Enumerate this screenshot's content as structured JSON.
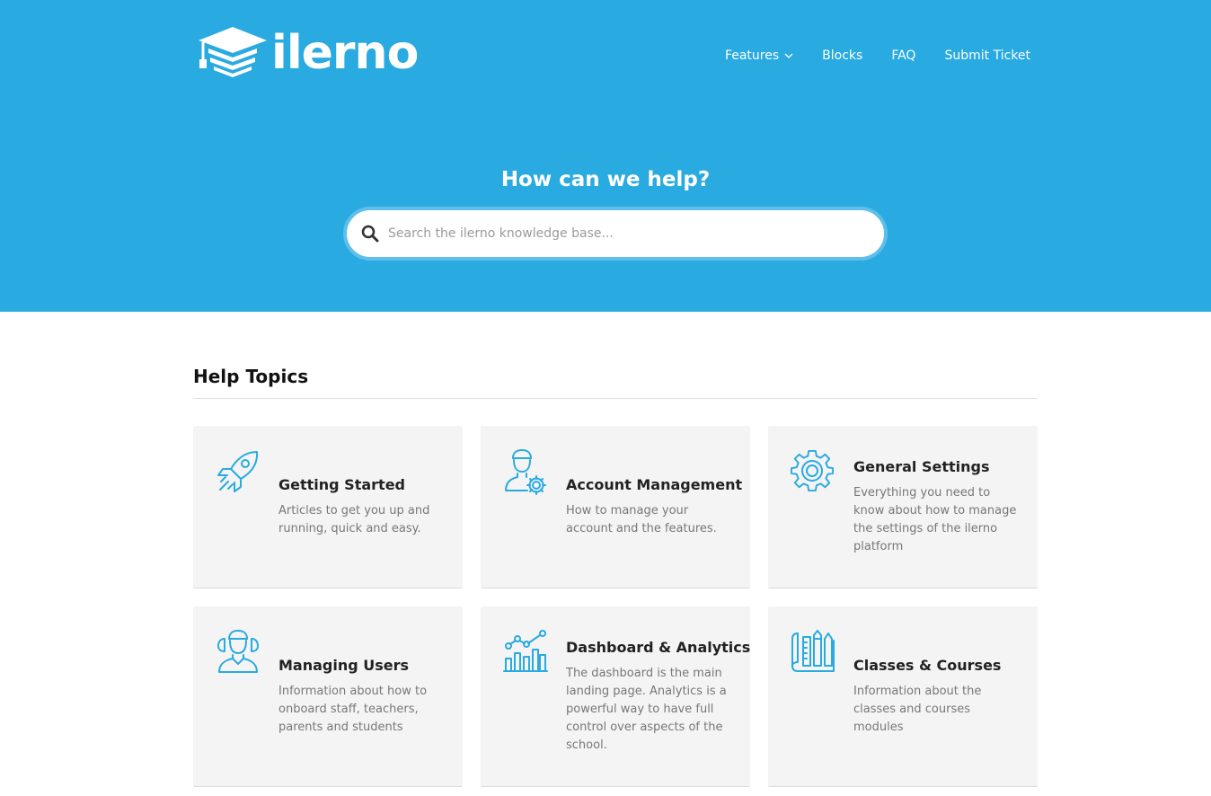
{
  "brand": {
    "name": "ilerno",
    "accent": "#29aae1"
  },
  "nav": {
    "items": [
      {
        "label": "Features"
      },
      {
        "label": "Blocks"
      },
      {
        "label": "FAQ"
      },
      {
        "label": "Submit Ticket"
      }
    ]
  },
  "hero": {
    "title": "How can we help?",
    "search_placeholder": "Search the ilerno knowledge base..."
  },
  "topics": {
    "heading": "Help Topics",
    "cards": [
      {
        "icon": "rocket-icon",
        "title": "Getting Started",
        "description": "Articles to get you up and running, quick and easy."
      },
      {
        "icon": "user-settings-icon",
        "title": "Account Management",
        "description": "How to manage your account and the features."
      },
      {
        "icon": "gear-icon",
        "title": "General Settings",
        "description": "Everything you need to know about how to manage the settings of the ilerno platform"
      },
      {
        "icon": "users-icon",
        "title": "Managing Users",
        "description": "Information about how to onboard staff, teachers, parents and students"
      },
      {
        "icon": "analytics-icon",
        "title": "Dashboard & Analytics",
        "description": "The dashboard is the main landing page. Analytics is a powerful way to have full control over aspects of the school."
      },
      {
        "icon": "book-tools-icon",
        "title": "Classes & Courses",
        "description": "Information about the classes and courses modules"
      }
    ]
  }
}
